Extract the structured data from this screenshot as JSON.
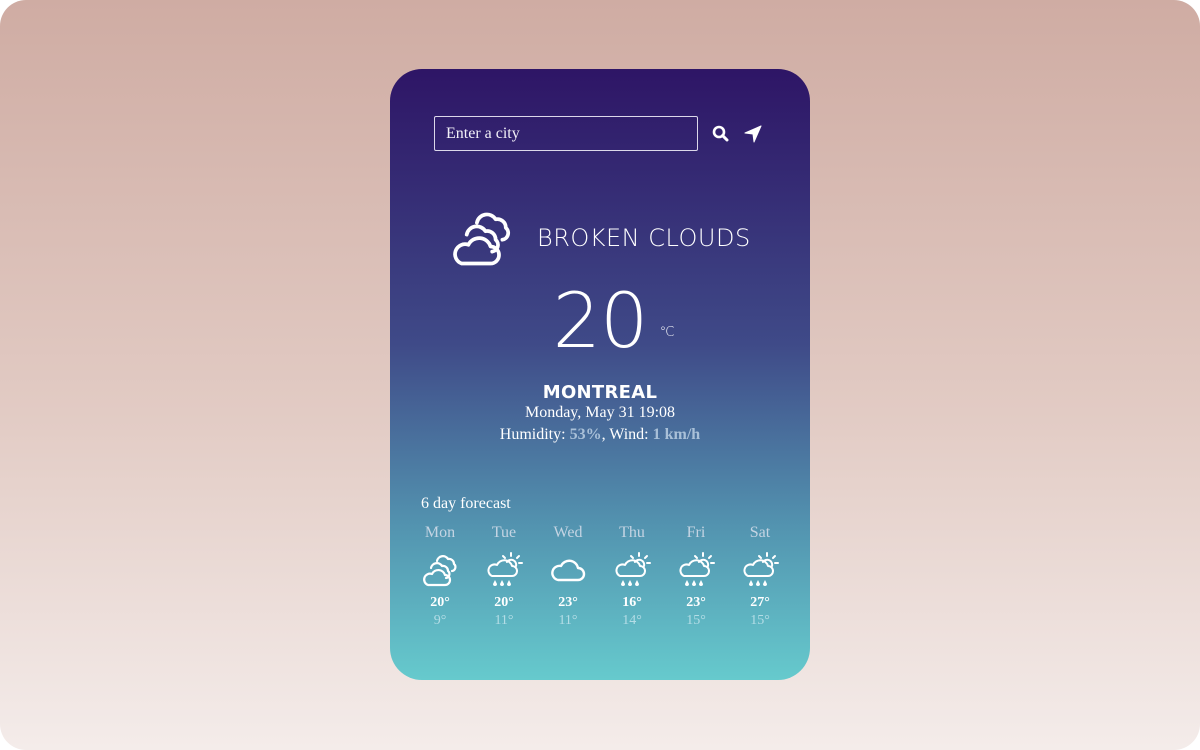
{
  "search": {
    "placeholder": "Enter a city",
    "value": "",
    "search_icon": "search-icon",
    "location_icon": "location-arrow-icon"
  },
  "current": {
    "icon": "broken-clouds-icon",
    "description": "BROKEN CLOUDS",
    "temperature": "20",
    "unit": "°C",
    "city": "MONTREAL",
    "datetime": "Monday, May 31 19:08",
    "humidity_label": "Humidity: ",
    "humidity_value": "53%",
    "wind_label": ", Wind: ",
    "wind_value": "1 km/h"
  },
  "forecast": {
    "title": "6 day forecast",
    "days": [
      {
        "day": "Mon",
        "icon": "broken-clouds-icon",
        "max": "20°",
        "min": "9°"
      },
      {
        "day": "Tue",
        "icon": "sun-cloud-rain-icon",
        "max": "20°",
        "min": "11°"
      },
      {
        "day": "Wed",
        "icon": "cloud-icon",
        "max": "23°",
        "min": "11°"
      },
      {
        "day": "Thu",
        "icon": "sun-cloud-rain-icon",
        "max": "16°",
        "min": "14°"
      },
      {
        "day": "Fri",
        "icon": "sun-cloud-rain-icon",
        "max": "23°",
        "min": "15°"
      },
      {
        "day": "Sat",
        "icon": "sun-cloud-rain-icon",
        "max": "27°",
        "min": "15°"
      }
    ]
  },
  "colors": {
    "card_top": "#2e1566",
    "card_bottom": "#66cacd",
    "highlight": "#a9c0d8"
  }
}
